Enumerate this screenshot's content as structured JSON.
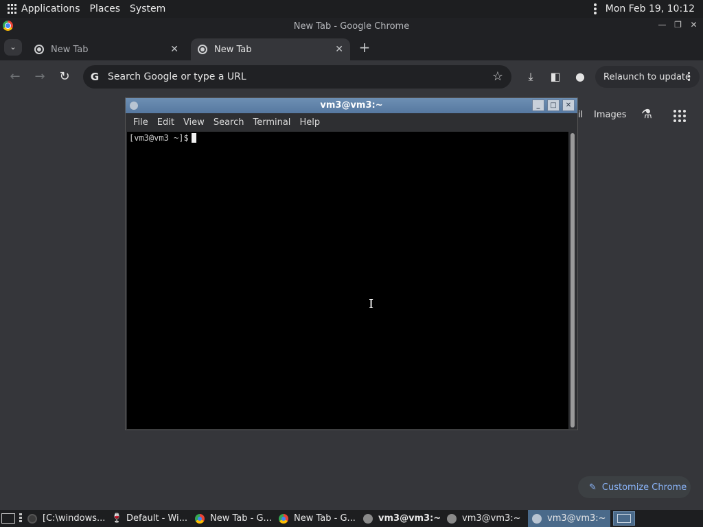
{
  "top_panel": {
    "menus": [
      "Applications",
      "Places",
      "System"
    ],
    "clock": "Mon Feb 19, 10:12"
  },
  "chrome": {
    "window_title": "New Tab - Google Chrome",
    "tabs": [
      {
        "label": "New Tab",
        "active": false
      },
      {
        "label": "New Tab",
        "active": true
      }
    ],
    "omnibox_placeholder": "Search Google or type a URL",
    "relaunch_label": "Relaunch to update",
    "ntp": {
      "partial_link": "il",
      "images_link": "Images",
      "customize_label": "Customize Chrome"
    }
  },
  "terminal": {
    "title": "vm3@vm3:~",
    "menus": [
      "File",
      "Edit",
      "View",
      "Search",
      "Terminal",
      "Help"
    ],
    "prompt": "[vm3@vm3 ~]$"
  },
  "taskbar": {
    "tasks": [
      {
        "label": "[C:\\windows...",
        "icon": "windows-icon",
        "bold": false,
        "selected": false
      },
      {
        "label": "Default - Wi...",
        "icon": "wine-icon",
        "bold": false,
        "selected": false
      },
      {
        "label": "New Tab - G...",
        "icon": "chrome-icon",
        "bold": false,
        "selected": false
      },
      {
        "label": "New Tab - G...",
        "icon": "chrome-icon",
        "bold": false,
        "selected": false
      },
      {
        "label": "vm3@vm3:~",
        "icon": "terminal-icon",
        "bold": true,
        "selected": false
      },
      {
        "label": "vm3@vm3:~",
        "icon": "terminal-icon",
        "bold": false,
        "selected": false
      },
      {
        "label": "vm3@vm3:~",
        "icon": "terminal-icon",
        "bold": false,
        "selected": true
      }
    ]
  },
  "colors": {
    "panel_bg": "#1d1e20",
    "chrome_frame": "#202124",
    "chrome_toolbar": "#35363a",
    "terminal_title": "#5678a0",
    "link_blue": "#8ab4f8"
  }
}
